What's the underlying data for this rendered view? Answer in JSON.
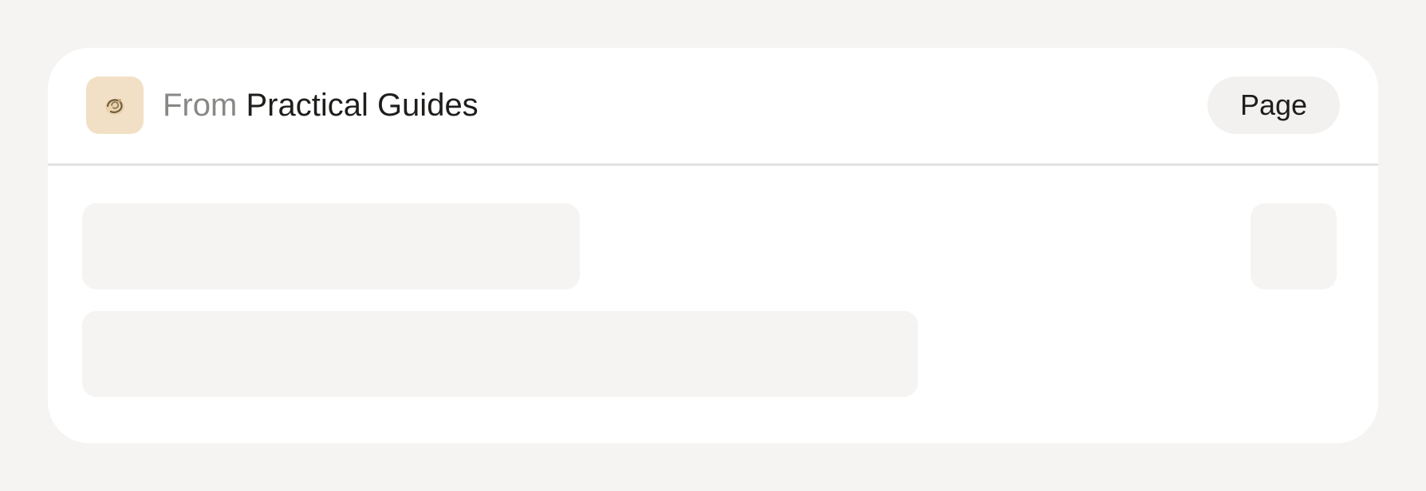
{
  "source": {
    "prefix": "From",
    "name": "Practical Guides",
    "icon": "guide-logo-icon",
    "icon_bg": "#f2e0c6"
  },
  "header": {
    "page_button_label": "Page"
  },
  "colors": {
    "background": "#f5f4f2",
    "card": "#ffffff",
    "skeleton": "#f5f4f2",
    "divider": "#e2e1df"
  },
  "content": {
    "loading_placeholders": [
      "title-placeholder",
      "thumbnail-placeholder",
      "description-placeholder"
    ]
  }
}
